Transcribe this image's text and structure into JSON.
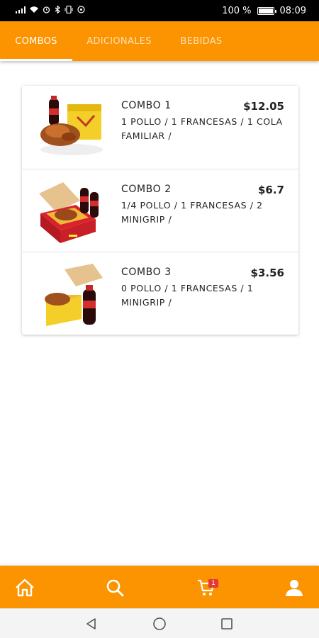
{
  "status_bar": {
    "left_icons": [
      "signal-icon",
      "wifi-icon",
      "alarm-icon",
      "bluetooth-icon",
      "vibrate-icon",
      "whatsapp-icon"
    ],
    "battery_label": "100 %",
    "time": "08:09"
  },
  "tabs": [
    {
      "label": "COMBOS",
      "active": true
    },
    {
      "label": "ADICIONALES",
      "active": false
    },
    {
      "label": "BEBIDAS",
      "active": false
    }
  ],
  "combos": [
    {
      "name": "COMBO 1",
      "price": "$12.05",
      "description": "1 POLLO / 1 FRANCESAS / 1 COLA FAMILIAR /"
    },
    {
      "name": "COMBO 2",
      "price": "$6.7",
      "description": "1/4 POLLO / 1 FRANCESAS / 2 MINIGRIP /"
    },
    {
      "name": "COMBO 3",
      "price": "$3.56",
      "description": "0 POLLO / 1 FRANCESAS / 1 MINIGRIP /"
    }
  ],
  "bottom_nav": {
    "items": [
      "home-icon",
      "search-icon",
      "cart-icon",
      "profile-icon"
    ],
    "cart_count": "1"
  },
  "colors": {
    "accent": "#fb9400",
    "badge": "#e53935"
  }
}
